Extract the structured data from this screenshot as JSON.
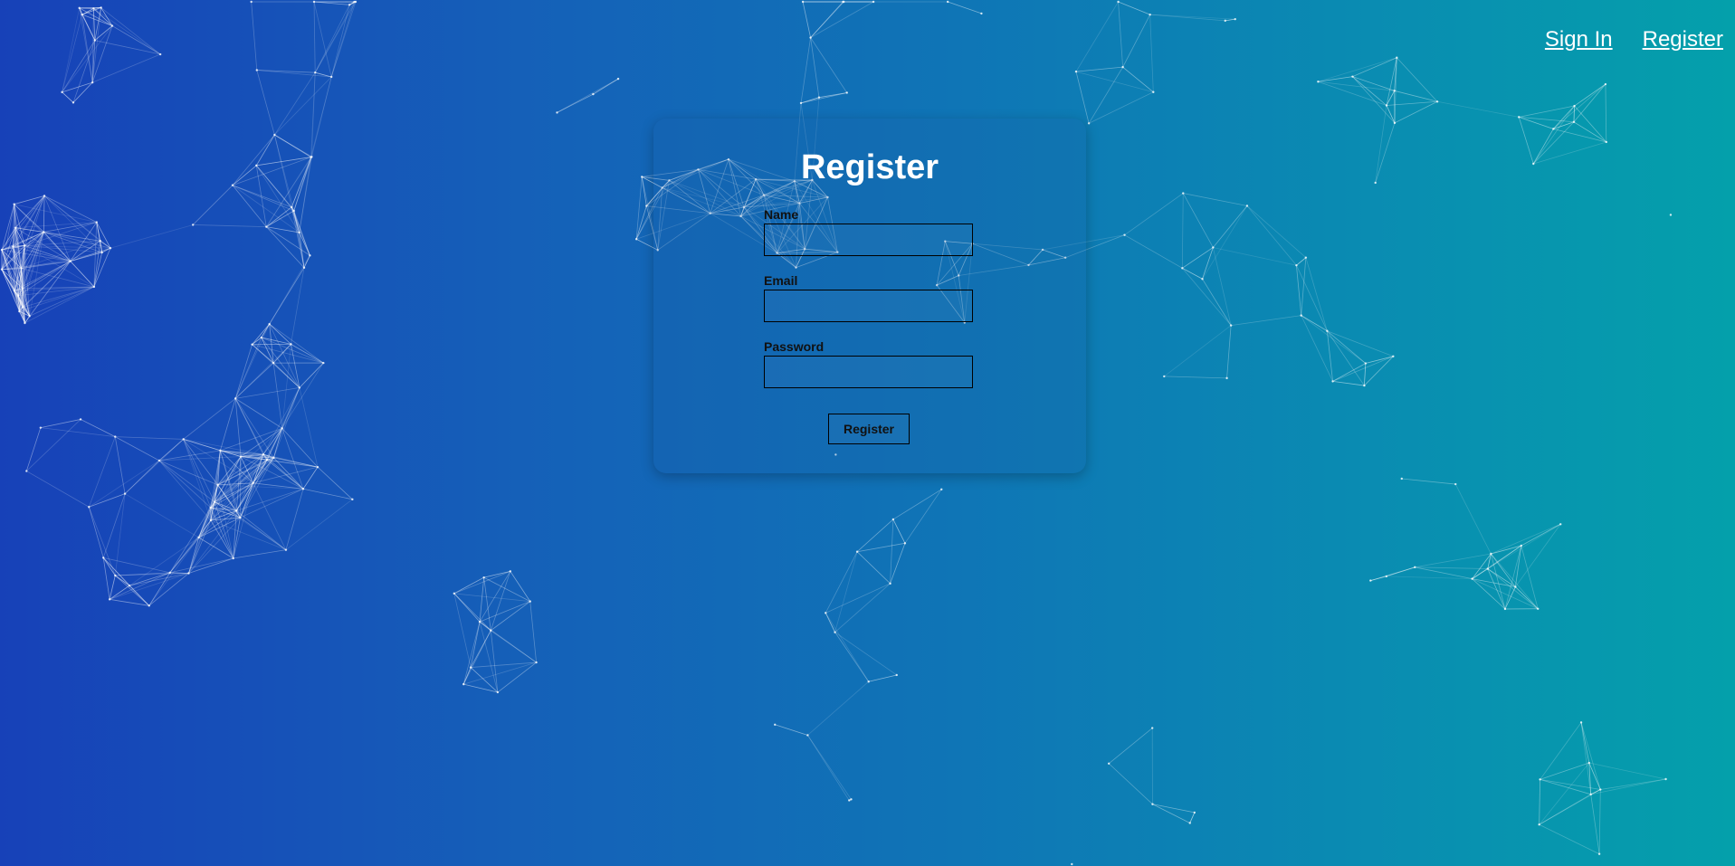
{
  "nav": {
    "sign_in": "Sign In",
    "register": "Register"
  },
  "form": {
    "title": "Register",
    "name_label": "Name",
    "name_value": "",
    "email_label": "Email",
    "email_value": "",
    "password_label": "Password",
    "password_value": "",
    "submit_label": "Register"
  },
  "colors": {
    "gradient_left": "#1741b8",
    "gradient_right": "#04a0ab",
    "text_light": "#ffffff",
    "text_dark": "#111111"
  }
}
